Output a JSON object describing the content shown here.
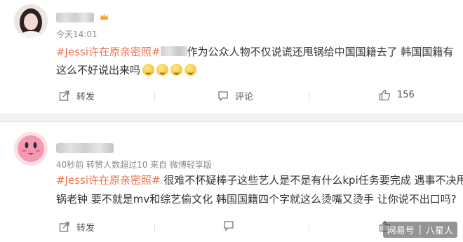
{
  "comments": [
    {
      "time": "今天14:01",
      "line1_tag": "#Jessi许在原亲密照#",
      "line1_text": "作为公众人物不仅说谎还甩锅给中国国籍去了 韩国国籍有",
      "line2_text": "这么不好说出来吗",
      "actions": {
        "repost": "转发",
        "comment": "评论",
        "like_count": "156"
      }
    },
    {
      "meta": "40秒前 转赞人数超过10 来自 微博轻享版",
      "line1_tag": "#Jessi许在原亲密照#",
      "line1_text": " 很难不怀疑棒子这些艺人是不是有什么kpi任务要完成 遇事不决甩",
      "line2_text": "锅老钟 要不就是mv和综艺偷文化 韩国国籍四个字就这么烫嘴又烫手 让你说不出口吗?",
      "actions": {
        "repost": "转发"
      }
    }
  ],
  "watermark": {
    "left": "网易号",
    "right": "八星人"
  },
  "colors": {
    "tag": "#eb7350",
    "meta": "#8a8a8a",
    "separator": "#f2f2f2"
  }
}
